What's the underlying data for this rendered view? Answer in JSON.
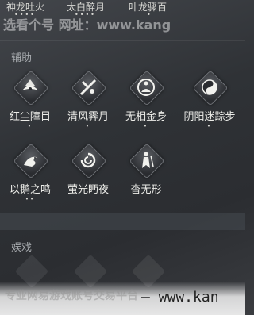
{
  "top_skills": [
    {
      "label": "神龙吐火",
      "dots": "••••"
    },
    {
      "label": "太白醉月",
      "dots": "••••"
    },
    {
      "label": "叶龙骤百",
      "dots": "•"
    }
  ],
  "watermark_top": "选看个号 网址：www.kang",
  "section_assist": {
    "title": "辅助"
  },
  "assist_row1": [
    {
      "label": "红尘障目",
      "dots": "•",
      "icon": "lotus-icon"
    },
    {
      "label": "清风霁月",
      "dots": "•",
      "icon": "crossed-sword-icon"
    },
    {
      "label": "无相金身",
      "dots": "•",
      "icon": "meditating-figure-icon"
    },
    {
      "label": "阴阳迷踪步",
      "dots": "•",
      "icon": "yin-yang-icon"
    }
  ],
  "assist_row2": [
    {
      "label": "以鹅之鸣",
      "dots": "••",
      "icon": "goose-icon"
    },
    {
      "label": "萤光眄夜",
      "dots": "",
      "icon": "swirl-icon"
    },
    {
      "label": "杳无形",
      "dots": "",
      "icon": "phantom-figure-icon"
    }
  ],
  "section_entertain": {
    "title": "娱戏"
  },
  "watermark_bottom": "专业网易游戏账号交易平台",
  "watermark_url": "— www.kan"
}
